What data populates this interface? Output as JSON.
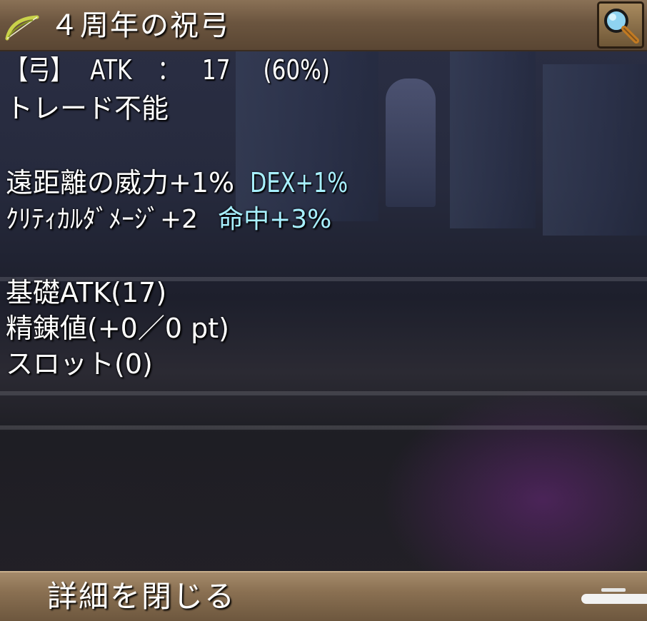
{
  "item": {
    "name": "４周年の祝弓",
    "icon": "bow-icon"
  },
  "stats": {
    "type_label": "【弓】",
    "atk_label": "ATK",
    "separator": "：",
    "atk_value": "17",
    "atk_percent": "(60%)",
    "trade": "トレード不能"
  },
  "options": {
    "line1_main": "遠距離の威力+1%",
    "line1_extra": "DEX+1%",
    "line2_main": "ｸﾘﾃｨｶﾙﾀﾞﾒｰｼﾞ+2",
    "line2_extra": "命中+3%"
  },
  "details": {
    "base_atk": "基礎ATK(17)",
    "refine": "精錬値(+0／0 pt)",
    "slot": "スロット(0)"
  },
  "footer": {
    "close_label": "詳細を閉じる"
  },
  "colors": {
    "option_highlight": "#a8f0ff",
    "frame": "#6b553f"
  }
}
